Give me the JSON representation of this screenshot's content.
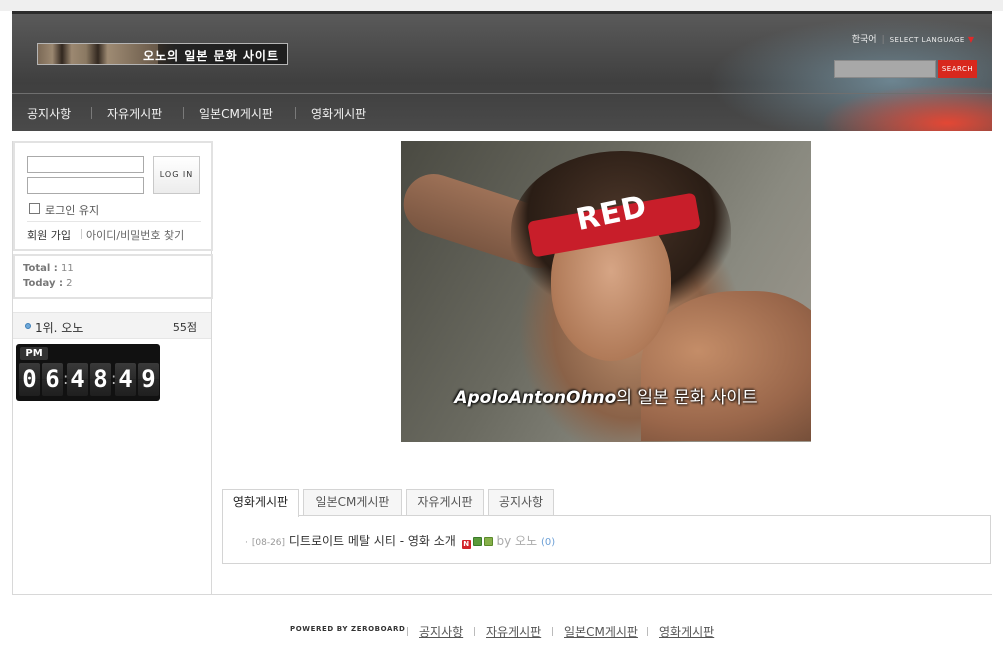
{
  "header": {
    "logo_text": "오노의 일본 문화 사이트",
    "language_current": "한국어",
    "language_select": "SELECT LANGUAGE",
    "search_placeholder": "",
    "search_button": "SEARCH"
  },
  "nav": {
    "items": [
      {
        "label": "공지사항"
      },
      {
        "label": "자유게시판"
      },
      {
        "label": "일본CM게시판"
      },
      {
        "label": "영화게시판"
      }
    ]
  },
  "login": {
    "id_value": "",
    "password_value": "",
    "button": "LOG IN",
    "keep_login": "로그인 유지",
    "join": "회원 가입",
    "find": "아이디/비밀번호 찾기"
  },
  "counter": {
    "total_label": "Total :",
    "total_value": "11",
    "today_label": "Today :",
    "today_value": "2"
  },
  "ranking": {
    "name": "1위. 오노",
    "score": "55점"
  },
  "clock": {
    "ampm": "PM",
    "h1": "0",
    "h2": "6",
    "m1": "4",
    "m2": "8",
    "s1": "4",
    "s2": "9"
  },
  "hero": {
    "band_text": "RED",
    "caption_bold": "ApoloAntonOhno",
    "caption_rest": "의 일본 문화 사이트"
  },
  "tabs": {
    "items": [
      {
        "label": "영화게시판"
      },
      {
        "label": "일본CM게시판"
      },
      {
        "label": "자유게시판"
      },
      {
        "label": "공지사항"
      }
    ],
    "active": "영화게시판"
  },
  "post": {
    "date": "[08-26]",
    "title": "디트로이트 메탈 시티 - 영화 소개",
    "new_icon": "N",
    "by": "by",
    "author": "오노",
    "comments": "(0)"
  },
  "footer": {
    "powered": "POWERED BY ZEROBOARD",
    "links": [
      {
        "label": "공지사항"
      },
      {
        "label": "자유게시판"
      },
      {
        "label": "일본CM게시판"
      },
      {
        "label": "영화게시판"
      }
    ]
  }
}
